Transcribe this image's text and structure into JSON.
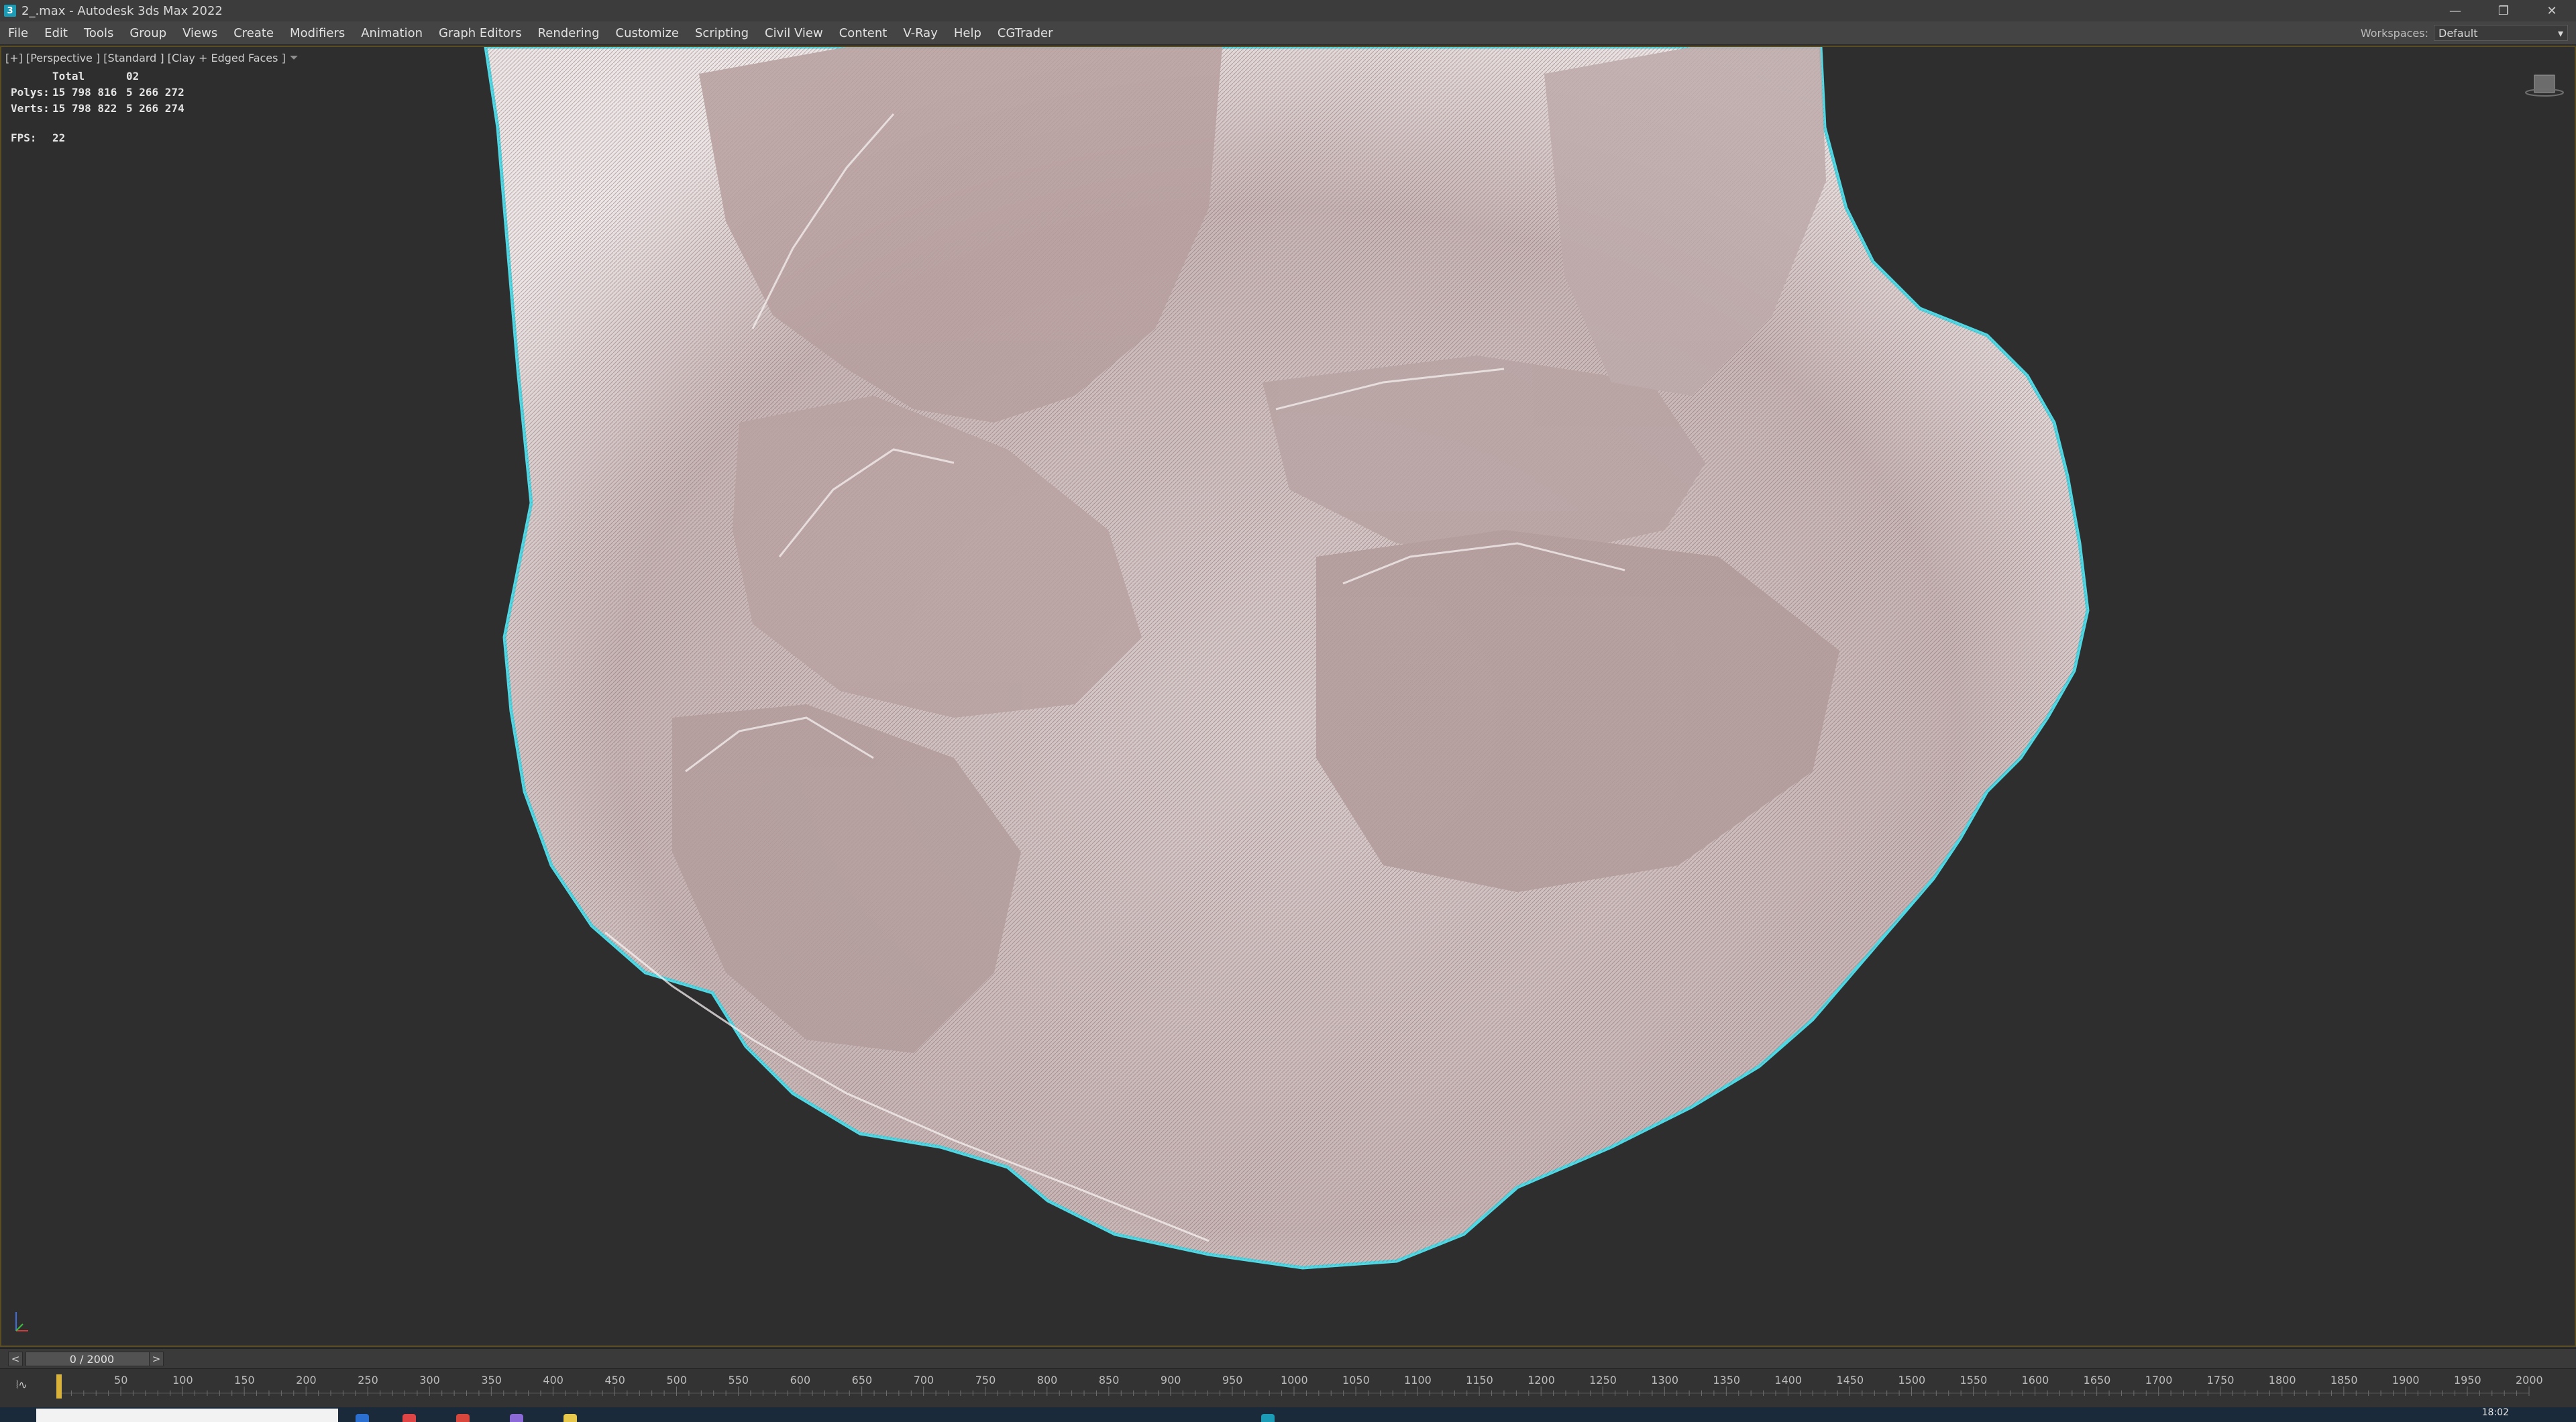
{
  "window": {
    "title": "2_.max - Autodesk 3ds Max 2022",
    "controls": [
      "—",
      "❐",
      "✕"
    ]
  },
  "menu": {
    "items": [
      "File",
      "Edit",
      "Tools",
      "Group",
      "Views",
      "Create",
      "Modifiers",
      "Animation",
      "Graph Editors",
      "Rendering",
      "Customize",
      "Scripting",
      "Civil View",
      "Content",
      "V-Ray",
      "Help",
      "CGTrader"
    ],
    "workspaces_label": "Workspaces:",
    "workspace_value": "Default"
  },
  "viewport": {
    "label": "[+] [Perspective ] [Standard ] [Clay + Edged Faces ]",
    "filter_icon": "funnel-icon",
    "stats": {
      "total_label": "Total",
      "total_value": "02",
      "polys_label": "Polys:",
      "polys_a": "15 798 816",
      "polys_b": "5 266 272",
      "verts_label": "Verts:",
      "verts_a": "15 798 822",
      "verts_b": "5 266 274",
      "fps_label": "FPS:",
      "fps_value": "22"
    },
    "selection_outline_color": "#4fd7e3",
    "model_color": "#d9cccc"
  },
  "timeline": {
    "frame_display": "0 / 2000",
    "prev_label": "<",
    "next_label": ">",
    "ticks": [
      "50",
      "100",
      "150",
      "200",
      "250",
      "300",
      "350",
      "400",
      "450",
      "500",
      "550",
      "600",
      "650",
      "700",
      "750",
      "800",
      "850",
      "900",
      "950",
      "1000",
      "1050",
      "1100",
      "1150",
      "1200",
      "1250",
      "1300",
      "1350",
      "1400",
      "1450",
      "1500",
      "1550",
      "1600",
      "1650",
      "1700",
      "1750",
      "1800",
      "1850",
      "1900",
      "1950",
      "2000"
    ],
    "tick_min": 0,
    "tick_max": 2000,
    "current_frame": 0
  },
  "taskbar": {
    "clock": "18:02"
  }
}
